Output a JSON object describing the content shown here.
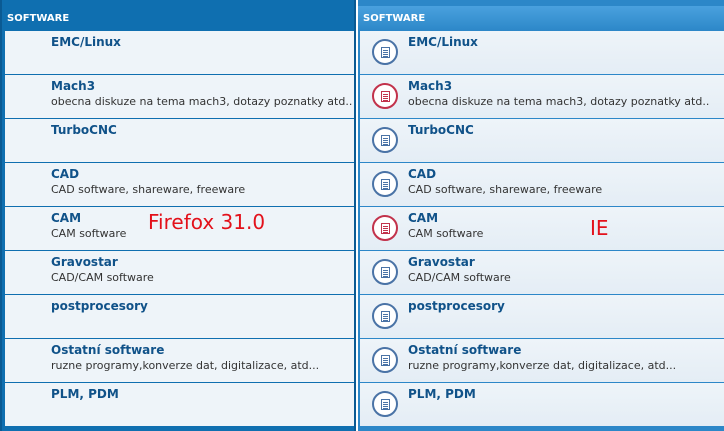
{
  "left_panel": {
    "header": "SOFTWARE",
    "forums": [
      {
        "title": "EMC/Linux",
        "desc": ""
      },
      {
        "title": "Mach3",
        "desc": "obecna diskuze na tema mach3, dotazy poznatky atd.."
      },
      {
        "title": "TurboCNC",
        "desc": ""
      },
      {
        "title": "CAD",
        "desc": "CAD software, shareware, freeware"
      },
      {
        "title": "CAM",
        "desc": "CAM software"
      },
      {
        "title": "Gravostar",
        "desc": "CAD/CAM software"
      },
      {
        "title": "postprocesory",
        "desc": ""
      },
      {
        "title": "Ostatní software",
        "desc": "ruzne programy,konverze dat, digitalizace, atd..."
      },
      {
        "title": "PLM, PDM",
        "desc": ""
      }
    ]
  },
  "right_panel": {
    "header": "SOFTWARE",
    "forums": [
      {
        "title": "EMC/Linux",
        "desc": "",
        "icon": "forum-read-icon"
      },
      {
        "title": "Mach3",
        "desc": "obecna diskuze na tema mach3, dotazy poznatky atd..",
        "icon": "forum-unread-icon"
      },
      {
        "title": "TurboCNC",
        "desc": "",
        "icon": "forum-read-icon"
      },
      {
        "title": "CAD",
        "desc": "CAD software, shareware, freeware",
        "icon": "forum-read-icon"
      },
      {
        "title": "CAM",
        "desc": "CAM software",
        "icon": "forum-unread-icon"
      },
      {
        "title": "Gravostar",
        "desc": "CAD/CAM software",
        "icon": "forum-read-icon"
      },
      {
        "title": "postprocesory",
        "desc": "",
        "icon": "forum-read-icon"
      },
      {
        "title": "Ostatní software",
        "desc": "ruzne programy,konverze dat, digitalizace, atd...",
        "icon": "forum-read-icon"
      },
      {
        "title": "PLM, PDM",
        "desc": "",
        "icon": "forum-read-icon"
      }
    ]
  },
  "annotations": {
    "left": "Firefox 31.0",
    "right": "IE"
  },
  "colors": {
    "header_bg": "#0f6fb0",
    "row_bg": "#eef4f9",
    "title_text": "#105289",
    "icon_read": "#4a73a6",
    "icon_unread": "#c2324b",
    "annotation": "#e3111b"
  }
}
